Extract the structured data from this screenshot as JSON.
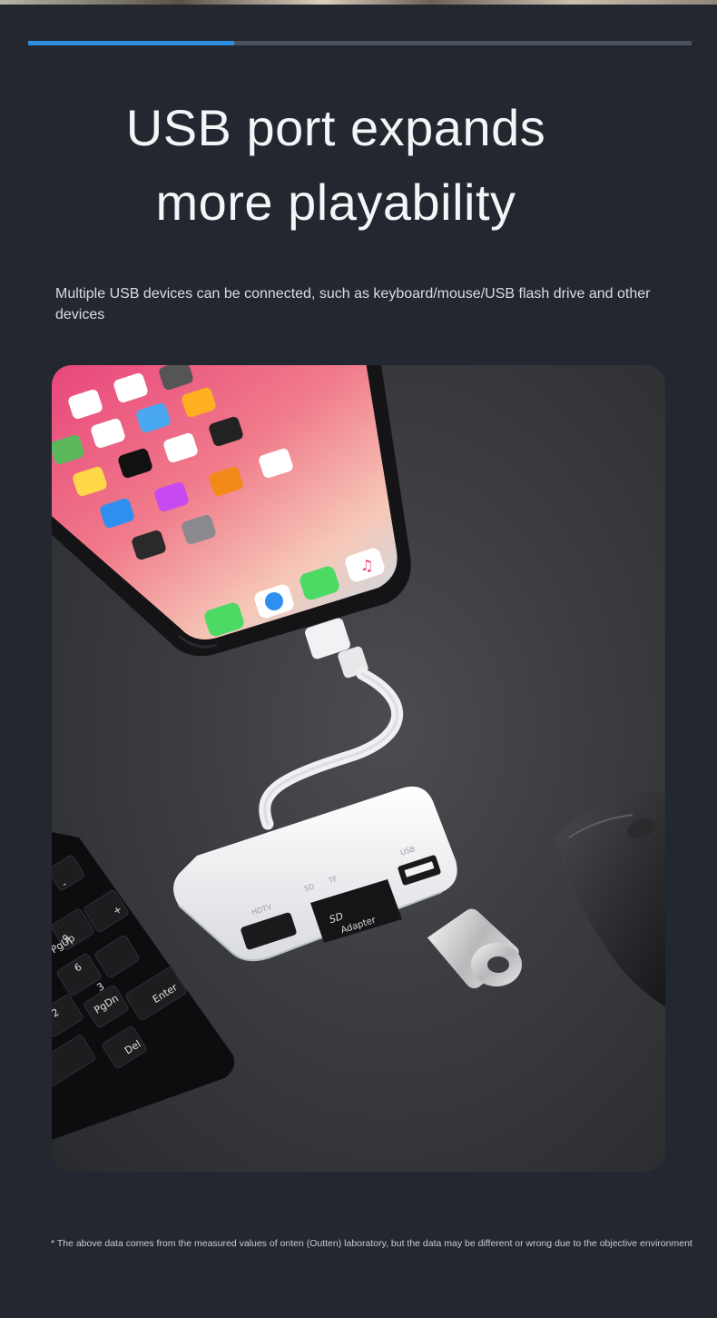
{
  "header": {
    "headline_line1": "USB port expands",
    "headline_line2": "more playability",
    "progress_fraction": 0.31
  },
  "description": "Multiple USB devices can be connected, such as keyboard/mouse/USB flash drive and other devices",
  "product_photo": {
    "phone_dock_icons": [
      "phone-icon",
      "safari-icon",
      "messages-icon",
      "music-icon"
    ],
    "adapter_port_labels": {
      "hdmi": "HDTV",
      "sd": "SD",
      "tf": "TF",
      "usb": "USB"
    },
    "sd_card_label": "Adapter",
    "keyboard_keys": [
      "PgUp",
      "6",
      "3",
      "PgDn",
      "Enter",
      "Del",
      "+",
      "-",
      "9",
      "2"
    ]
  },
  "footnote": "* The above data comes from the measured values of onten (Outten) laboratory, but the data may be different or wrong due to the objective environment",
  "colors": {
    "background": "#23272f",
    "accent": "#2e8fe0",
    "track": "#4a5260"
  }
}
